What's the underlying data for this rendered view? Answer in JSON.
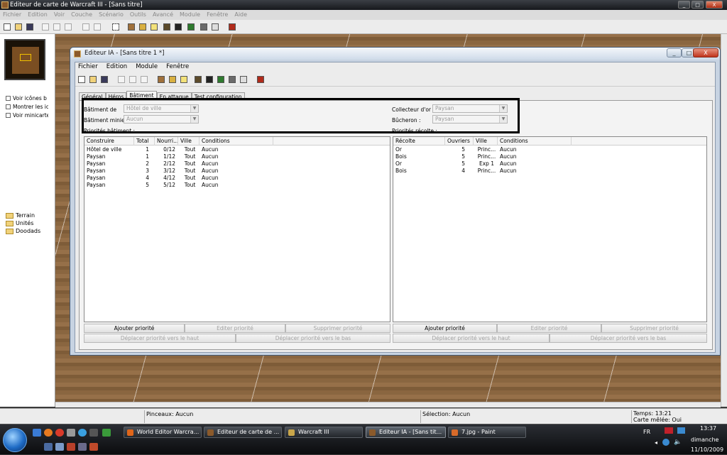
{
  "outer_window": {
    "title": "Editeur de carte de Warcraft III - [Sans titre]",
    "menu": [
      "Fichier",
      "Edition",
      "Voir",
      "Couche",
      "Scénario",
      "Outils",
      "Avancé",
      "Module",
      "Fenêtre",
      "Aide"
    ],
    "controls": {
      "minimize": "_",
      "maximize": "□",
      "close": "X"
    }
  },
  "left_panel": {
    "checkboxes": [
      "Voir icônes b",
      "Montrer les ic",
      "Voir minicarte"
    ],
    "tree": [
      "Terrain",
      "Unités",
      "Doodads"
    ]
  },
  "status_bar": {
    "brush": "Pinceaux: Aucun",
    "selection": "Sélection: Aucun",
    "time": "Temps: 13:21",
    "mode": "Carte mêlée: Oui"
  },
  "ia_window": {
    "title": "Editeur IA - [Sans titre 1 *]",
    "menu": [
      "Fichier",
      "Edition",
      "Module",
      "Fenêtre"
    ],
    "tabs": [
      "Général",
      "Héros",
      "Bâtiment",
      "En attaque",
      "Test configuration"
    ],
    "selected_tab": "Bâtiment",
    "fields": {
      "batiment_de": {
        "label": "Bâtiment de",
        "value": "Hôtel de ville"
      },
      "batiment_minier": {
        "label": "Bâtiment minier :",
        "value": "Aucun"
      },
      "collecteur_or": {
        "label": "Collecteur d'or :",
        "value": "Paysan"
      },
      "bucheron": {
        "label": "Bûcheron :",
        "value": "Paysan"
      }
    },
    "priorites_batiment": {
      "label": "Priorités bâtiment :",
      "columns": [
        "Construire",
        "Total",
        "Nourri...",
        "Ville",
        "Conditions"
      ],
      "rows": [
        [
          "Hôtel de ville",
          "1",
          "0/12",
          "Tout",
          "Aucun"
        ],
        [
          "Paysan",
          "1",
          "1/12",
          "Tout",
          "Aucun"
        ],
        [
          "Paysan",
          "2",
          "2/12",
          "Tout",
          "Aucun"
        ],
        [
          "Paysan",
          "3",
          "3/12",
          "Tout",
          "Aucun"
        ],
        [
          "Paysan",
          "4",
          "4/12",
          "Tout",
          "Aucun"
        ],
        [
          "Paysan",
          "5",
          "5/12",
          "Tout",
          "Aucun"
        ]
      ]
    },
    "priorites_recolte": {
      "label": "Priorités récolte :",
      "columns": [
        "Récolte",
        "Ouvriers",
        "Ville",
        "Conditions"
      ],
      "rows": [
        [
          "Or",
          "5",
          "Princ...",
          "Aucun"
        ],
        [
          "Bois",
          "5",
          "Princ...",
          "Aucun"
        ],
        [
          "Or",
          "5",
          "Exp 1",
          "Aucun"
        ],
        [
          "Bois",
          "4",
          "Princ...",
          "Aucun"
        ]
      ]
    },
    "buttons": {
      "add": "Ajouter priorité",
      "edit": "Editer priorité",
      "delete": "Supprimer priorité",
      "move_up": "Déplacer priorité vers le haut",
      "move_down": "Déplacer priorité vers le bas"
    },
    "controls": {
      "minimize": "_",
      "maximize": "□",
      "close": "X"
    }
  },
  "taskbar": {
    "tasks": [
      {
        "label": "World Editor Warcra...",
        "color": "#e0661a"
      },
      {
        "label": "Editeur de carte de ...",
        "color": "#8b5a2b"
      },
      {
        "label": "Warcraft III",
        "color": "#c9a64a"
      },
      {
        "label": "Editeur IA - [Sans tit...",
        "color": "#8b5a2b"
      },
      {
        "label": "7.jpg - Paint",
        "color": "#d86b2a"
      }
    ],
    "active_task": "Editeur IA - [Sans tit...",
    "tray": {
      "lang": "FR",
      "time": "13:37",
      "day": "dimanche",
      "date": "11/10/2009"
    }
  },
  "colors": {
    "highlight_border": "#000000",
    "terrain": "#8a6640",
    "taskbar": "#1a1c20"
  }
}
